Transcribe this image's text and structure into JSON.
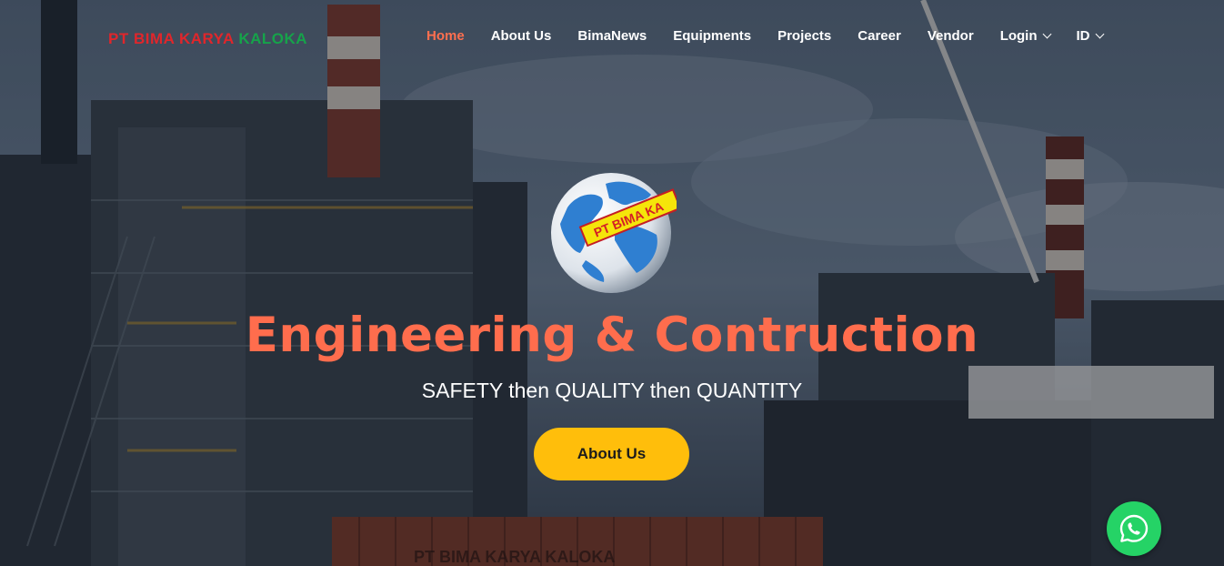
{
  "brand": {
    "name_part1": "PT BIMA KARYA",
    "name_part2": "KALOKA",
    "color_primary": "#e0262b",
    "color_secondary": "#16a34a"
  },
  "nav": {
    "items": [
      {
        "label": "Home",
        "active": true
      },
      {
        "label": "About Us"
      },
      {
        "label": "BimaNews"
      },
      {
        "label": "Equipments"
      },
      {
        "label": "Projects"
      },
      {
        "label": "Career"
      },
      {
        "label": "Vendor"
      },
      {
        "label": "Login",
        "dropdown": true,
        "icon": "chevron-down-icon"
      },
      {
        "label": "ID",
        "dropdown": true,
        "icon": "chevron-down-icon"
      }
    ],
    "active_color": "#ff6f4f"
  },
  "hero": {
    "logo_text": "PT BIMA KA",
    "headline": "Engineering & Contruction",
    "tagline": "SAFETY then QUALITY then QUANTITY",
    "cta_label": "About Us",
    "headline_color": "#ff6d4d",
    "cta_color": "#ffbe0b",
    "background_signage": "PT BIMA KARYA KALOKA"
  },
  "whatsapp": {
    "icon": "whatsapp-icon",
    "color": "#25d366"
  }
}
